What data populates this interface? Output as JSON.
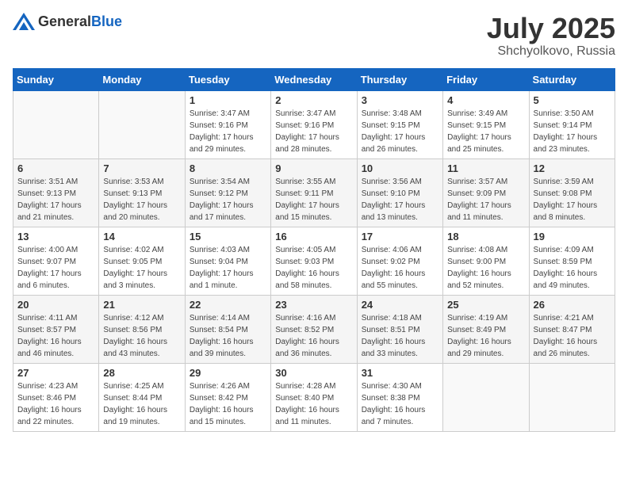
{
  "header": {
    "logo_general": "General",
    "logo_blue": "Blue",
    "month": "July 2025",
    "location": "Shchyolkovo, Russia"
  },
  "weekdays": [
    "Sunday",
    "Monday",
    "Tuesday",
    "Wednesday",
    "Thursday",
    "Friday",
    "Saturday"
  ],
  "weeks": [
    [
      {
        "day": "",
        "info": ""
      },
      {
        "day": "",
        "info": ""
      },
      {
        "day": "1",
        "info": "Sunrise: 3:47 AM\nSunset: 9:16 PM\nDaylight: 17 hours and 29 minutes."
      },
      {
        "day": "2",
        "info": "Sunrise: 3:47 AM\nSunset: 9:16 PM\nDaylight: 17 hours and 28 minutes."
      },
      {
        "day": "3",
        "info": "Sunrise: 3:48 AM\nSunset: 9:15 PM\nDaylight: 17 hours and 26 minutes."
      },
      {
        "day": "4",
        "info": "Sunrise: 3:49 AM\nSunset: 9:15 PM\nDaylight: 17 hours and 25 minutes."
      },
      {
        "day": "5",
        "info": "Sunrise: 3:50 AM\nSunset: 9:14 PM\nDaylight: 17 hours and 23 minutes."
      }
    ],
    [
      {
        "day": "6",
        "info": "Sunrise: 3:51 AM\nSunset: 9:13 PM\nDaylight: 17 hours and 21 minutes."
      },
      {
        "day": "7",
        "info": "Sunrise: 3:53 AM\nSunset: 9:13 PM\nDaylight: 17 hours and 20 minutes."
      },
      {
        "day": "8",
        "info": "Sunrise: 3:54 AM\nSunset: 9:12 PM\nDaylight: 17 hours and 17 minutes."
      },
      {
        "day": "9",
        "info": "Sunrise: 3:55 AM\nSunset: 9:11 PM\nDaylight: 17 hours and 15 minutes."
      },
      {
        "day": "10",
        "info": "Sunrise: 3:56 AM\nSunset: 9:10 PM\nDaylight: 17 hours and 13 minutes."
      },
      {
        "day": "11",
        "info": "Sunrise: 3:57 AM\nSunset: 9:09 PM\nDaylight: 17 hours and 11 minutes."
      },
      {
        "day": "12",
        "info": "Sunrise: 3:59 AM\nSunset: 9:08 PM\nDaylight: 17 hours and 8 minutes."
      }
    ],
    [
      {
        "day": "13",
        "info": "Sunrise: 4:00 AM\nSunset: 9:07 PM\nDaylight: 17 hours and 6 minutes."
      },
      {
        "day": "14",
        "info": "Sunrise: 4:02 AM\nSunset: 9:05 PM\nDaylight: 17 hours and 3 minutes."
      },
      {
        "day": "15",
        "info": "Sunrise: 4:03 AM\nSunset: 9:04 PM\nDaylight: 17 hours and 1 minute."
      },
      {
        "day": "16",
        "info": "Sunrise: 4:05 AM\nSunset: 9:03 PM\nDaylight: 16 hours and 58 minutes."
      },
      {
        "day": "17",
        "info": "Sunrise: 4:06 AM\nSunset: 9:02 PM\nDaylight: 16 hours and 55 minutes."
      },
      {
        "day": "18",
        "info": "Sunrise: 4:08 AM\nSunset: 9:00 PM\nDaylight: 16 hours and 52 minutes."
      },
      {
        "day": "19",
        "info": "Sunrise: 4:09 AM\nSunset: 8:59 PM\nDaylight: 16 hours and 49 minutes."
      }
    ],
    [
      {
        "day": "20",
        "info": "Sunrise: 4:11 AM\nSunset: 8:57 PM\nDaylight: 16 hours and 46 minutes."
      },
      {
        "day": "21",
        "info": "Sunrise: 4:12 AM\nSunset: 8:56 PM\nDaylight: 16 hours and 43 minutes."
      },
      {
        "day": "22",
        "info": "Sunrise: 4:14 AM\nSunset: 8:54 PM\nDaylight: 16 hours and 39 minutes."
      },
      {
        "day": "23",
        "info": "Sunrise: 4:16 AM\nSunset: 8:52 PM\nDaylight: 16 hours and 36 minutes."
      },
      {
        "day": "24",
        "info": "Sunrise: 4:18 AM\nSunset: 8:51 PM\nDaylight: 16 hours and 33 minutes."
      },
      {
        "day": "25",
        "info": "Sunrise: 4:19 AM\nSunset: 8:49 PM\nDaylight: 16 hours and 29 minutes."
      },
      {
        "day": "26",
        "info": "Sunrise: 4:21 AM\nSunset: 8:47 PM\nDaylight: 16 hours and 26 minutes."
      }
    ],
    [
      {
        "day": "27",
        "info": "Sunrise: 4:23 AM\nSunset: 8:46 PM\nDaylight: 16 hours and 22 minutes."
      },
      {
        "day": "28",
        "info": "Sunrise: 4:25 AM\nSunset: 8:44 PM\nDaylight: 16 hours and 19 minutes."
      },
      {
        "day": "29",
        "info": "Sunrise: 4:26 AM\nSunset: 8:42 PM\nDaylight: 16 hours and 15 minutes."
      },
      {
        "day": "30",
        "info": "Sunrise: 4:28 AM\nSunset: 8:40 PM\nDaylight: 16 hours and 11 minutes."
      },
      {
        "day": "31",
        "info": "Sunrise: 4:30 AM\nSunset: 8:38 PM\nDaylight: 16 hours and 7 minutes."
      },
      {
        "day": "",
        "info": ""
      },
      {
        "day": "",
        "info": ""
      }
    ]
  ]
}
